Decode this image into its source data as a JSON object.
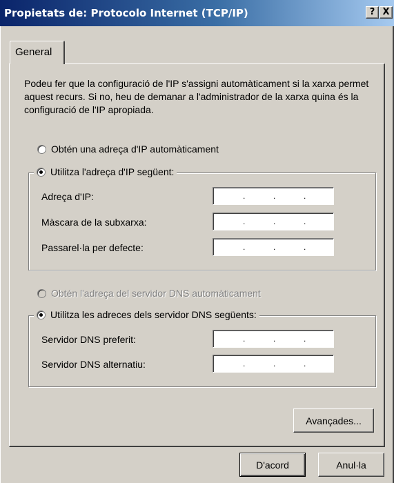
{
  "window": {
    "title": "Propietats de: Protocolo Internet (TCP/IP)",
    "help_button": "?",
    "close_button": "X"
  },
  "tabs": [
    {
      "label": "General",
      "selected": true
    }
  ],
  "intro_text": "Podeu fer que la configuració de l'IP s'assigni automàticament si la xarxa permet aquest recurs. Si no, heu de demanar a l'administrador de la xarxa quina és la configuració de l'IP apropiada.",
  "ip_settings": {
    "auto_option": {
      "label": "Obtén una adreça d'IP automàticament",
      "checked": false,
      "enabled": true
    },
    "manual_option": {
      "label": "Utilitza l'adreça d'IP següent:",
      "checked": true,
      "enabled": true
    },
    "fields": [
      {
        "label": "Adreça d'IP:",
        "value": " .  .  . "
      },
      {
        "label": "Màscara de la subxarxa:",
        "value": " .  .  . "
      },
      {
        "label": "Passarel·la per defecte:",
        "value": " .  .  . "
      }
    ]
  },
  "dns_settings": {
    "auto_option": {
      "label": "Obtén l'adreça del servidor DNS automàticament",
      "checked": false,
      "enabled": false
    },
    "manual_option": {
      "label": "Utilitza les adreces dels servidor DNS següents:",
      "checked": true,
      "enabled": true
    },
    "fields": [
      {
        "label": "Servidor DNS preferit:",
        "value": " .  .  . "
      },
      {
        "label": "Servidor DNS alternatiu:",
        "value": " .  .  . "
      }
    ]
  },
  "buttons": {
    "advanced": "Avançades...",
    "ok": "D'acord",
    "cancel": "Anul·la"
  },
  "colors": {
    "titlebar_start": "#0a246a",
    "titlebar_end": "#a6caf0",
    "dialog_face": "#d4d0c8"
  }
}
